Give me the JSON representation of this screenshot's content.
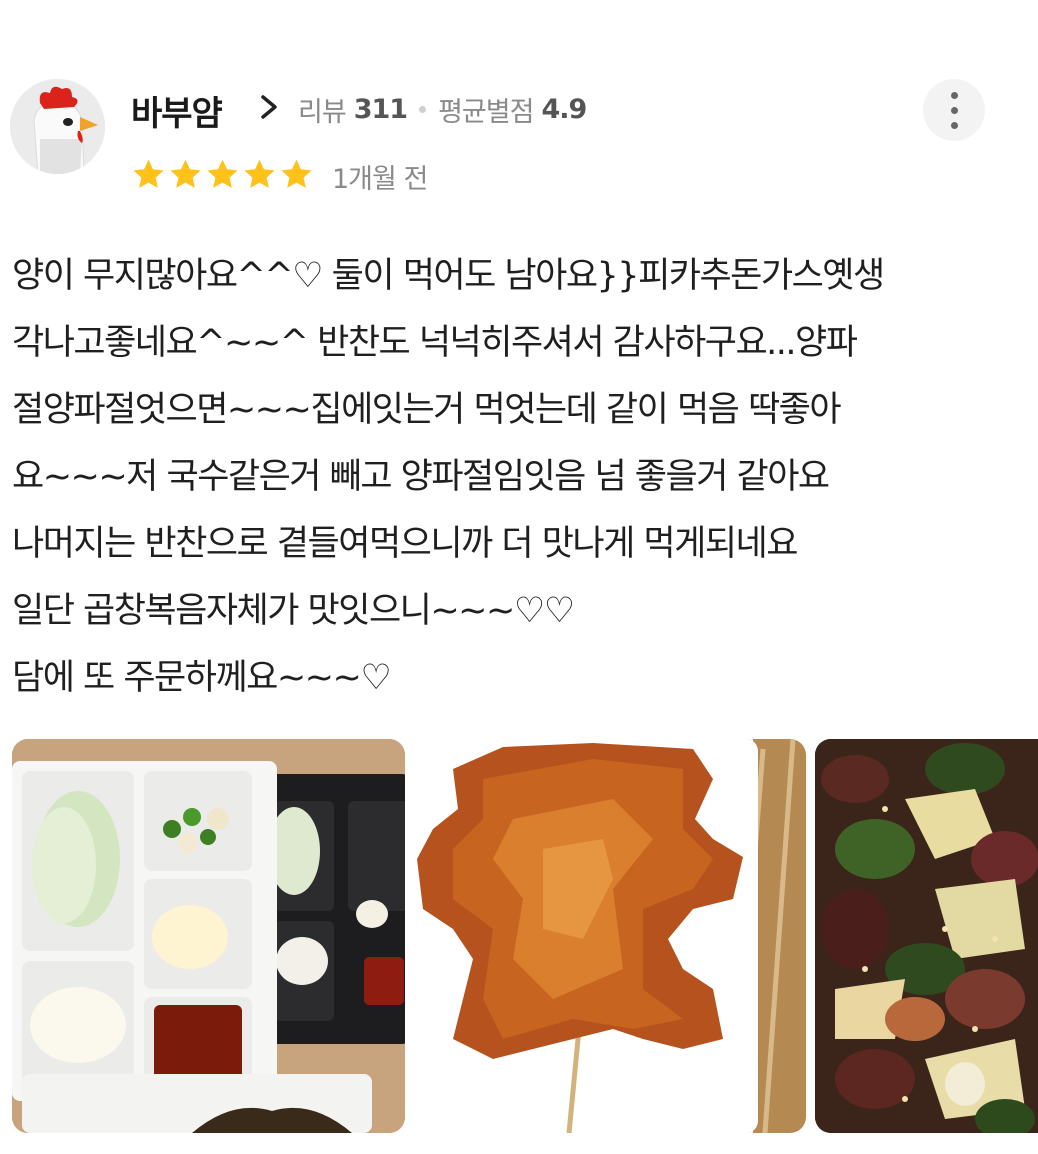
{
  "review": {
    "reviewer": {
      "name": "바부얌",
      "avatar_icon": "chicken-avatar",
      "review_count_label": "리뷰",
      "review_count": "311",
      "average_rating_label": "평균별점",
      "average_rating": "4.9"
    },
    "rating": 5,
    "rating_max": 5,
    "time_ago": "1개월 전",
    "text_lines": [
      "양이 무지많아요^^♡ 둘이 먹어도 남아요}}피카추돈가스옛생",
      "각나고좋네요^~~^ 반찬도 넉넉히주셔서 감사하구요...양파",
      "절양파절엇으면~~~집에잇는거 먹엇는데 같이 먹음 딱좋아",
      "요~~~저 국수같은거 빼고 양파절임잇음 넘 좋을거 같아요",
      "나머지는 반찬으로 곁들여먹으니까 더 맛나게 먹게되네요",
      "일단 곱창복음자체가 맛잇으니~~~♡♡",
      "담에 또 주문하께요~~~♡"
    ],
    "photos": [
      "side-dishes-photo",
      "fried-cutlet-photo",
      "stir-fried-gopchang-photo"
    ]
  },
  "colors": {
    "star": "#FFC21A",
    "text": "#1f1f1f",
    "muted": "#8a8a8a"
  }
}
